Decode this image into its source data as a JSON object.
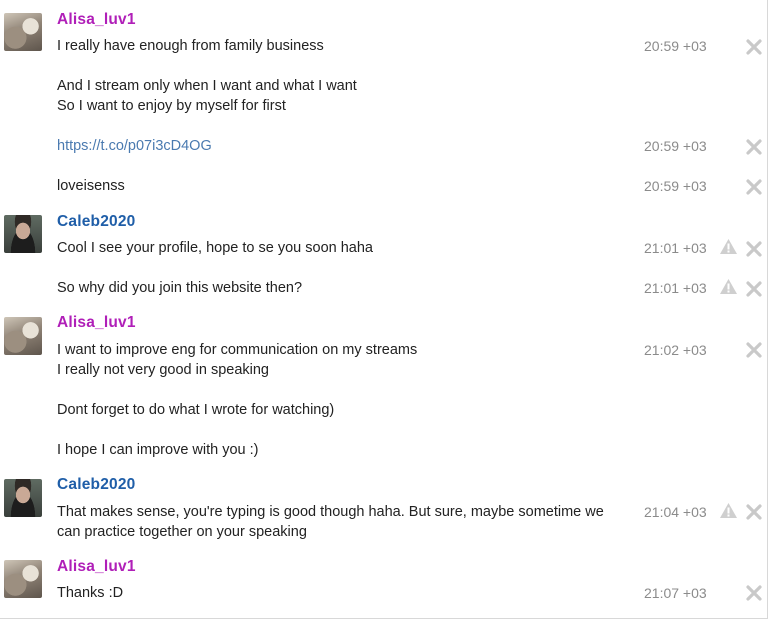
{
  "users": {
    "alisa": {
      "name": "Alisa_luv1",
      "color": "#b01fb8"
    },
    "caleb": {
      "name": "Caleb2020",
      "color": "#1f5ea8"
    }
  },
  "groups": [
    {
      "user": "Alisa_luv1",
      "messages": [
        {
          "lines": [
            "I really have enough from family business",
            "",
            "And I stream only when I want and what I want",
            "So I want to enjoy by myself for first"
          ],
          "time": "20:59 +03",
          "warn": false
        },
        {
          "lines": [
            "https://t.co/p07i3cD4OG"
          ],
          "time": "20:59 +03",
          "warn": false,
          "is_link": true
        },
        {
          "lines": [
            "loveisenss"
          ],
          "time": "20:59 +03",
          "warn": false
        }
      ]
    },
    {
      "user": "Caleb2020",
      "messages": [
        {
          "lines": [
            "Cool I see your profile, hope to se you soon haha"
          ],
          "time": "21:01 +03",
          "warn": true
        },
        {
          "lines": [
            "So why did you join this website then?"
          ],
          "time": "21:01 +03",
          "warn": true
        }
      ]
    },
    {
      "user": "Alisa_luv1",
      "messages": [
        {
          "lines": [
            "I want to improve eng for communication on my streams",
            "I really not very good in speaking",
            "",
            "Dont forget to do what I wrote for watching)",
            "",
            "I hope I can improve with you :)"
          ],
          "time": "21:02 +03",
          "warn": false
        }
      ]
    },
    {
      "user": "Caleb2020",
      "messages": [
        {
          "lines": [
            "That makes sense, you're typing is good though haha. But sure, maybe sometime we",
            "can practice together on your speaking"
          ],
          "time": "21:04 +03",
          "warn": true
        }
      ]
    },
    {
      "user": "Alisa_luv1",
      "messages": [
        {
          "lines": [
            "Thanks :D"
          ],
          "time": "21:07 +03",
          "warn": false
        }
      ]
    }
  ],
  "icons": {
    "warn": "warning-icon",
    "close": "close-icon",
    "avatar_alisa": "avatar-photo",
    "avatar_caleb": "avatar-photo"
  }
}
